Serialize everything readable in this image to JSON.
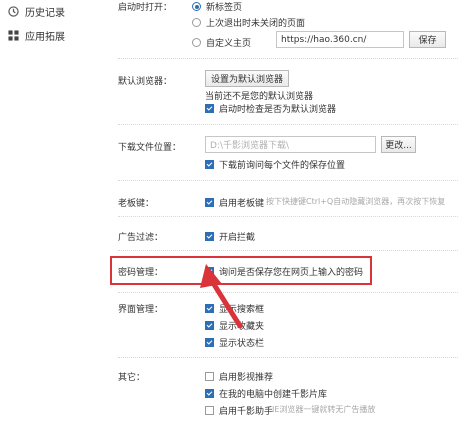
{
  "sidebar": {
    "items": [
      {
        "label": "历史记录",
        "icon": "history-icon"
      },
      {
        "label": "应用拓展",
        "icon": "apps-grid-icon"
      }
    ]
  },
  "startup": {
    "label": "启动时打开：",
    "options": [
      "新标签页",
      "上次退出时未关闭的页面",
      "自定义主页"
    ],
    "homepage_value": "https://hao.360.cn/",
    "save_label": "保存"
  },
  "default_browser": {
    "label": "默认浏览器：",
    "button_label": "设置为默认浏览器",
    "status_text": "当前还不是您的默认浏览器",
    "check_label": "启动时检查是否为默认浏览器"
  },
  "download": {
    "label": "下载文件位置：",
    "path_value": "D:\\千影浏览器下载\\",
    "change_label": "更改...",
    "ask_label": "下载前询问每个文件的保存位置"
  },
  "boss_key": {
    "label": "老板键：",
    "check_label": "启用老板键",
    "hint": "按下快捷键Ctrl+Q自动隐藏浏览器，再次按下恢复"
  },
  "ad_filter": {
    "label": "广告过滤：",
    "check_label": "开启拦截"
  },
  "password": {
    "label": "密码管理：",
    "check_label": "询问是否保存您在网页上输入的密码"
  },
  "interface": {
    "label": "界面管理：",
    "items": [
      "显示搜索框",
      "显示收藏夹",
      "显示状态栏"
    ]
  },
  "other": {
    "label": "其它：",
    "items": [
      "启用影视推荐",
      "在我的电脑中创建千影片库",
      "启用千影助手"
    ],
    "helper_hint": "IE浏览器一键就转无广告播放"
  },
  "colors": {
    "accent": "#2d6fb7",
    "highlight": "#d9343a"
  }
}
